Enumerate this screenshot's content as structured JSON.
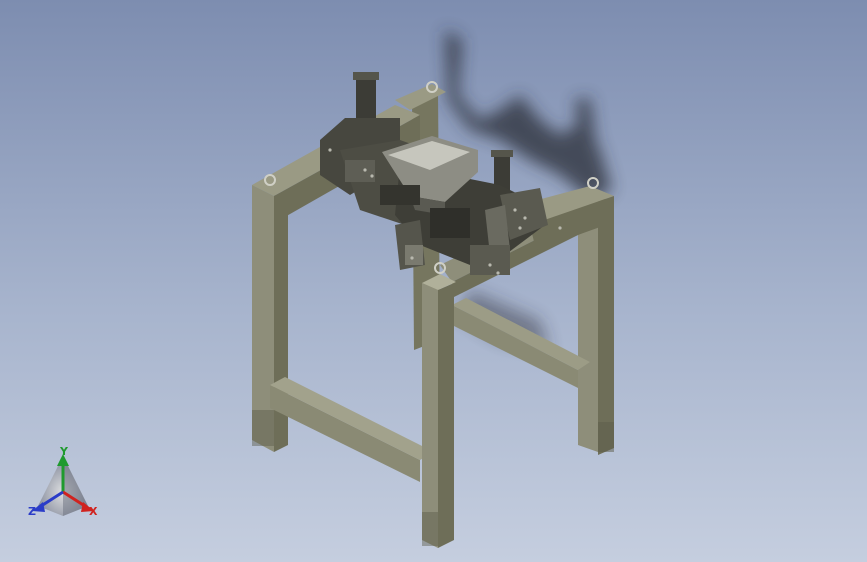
{
  "view_triad": {
    "y_label": "Y",
    "x_label": "X",
    "z_label": "Z",
    "colors": {
      "y": "#1f9a2e",
      "x": "#d0231f",
      "z": "#2a3cc8"
    }
  },
  "colors": {
    "background_top": "#7d8db0",
    "background_bottom": "#c5cedf",
    "frame_light": "#8e8e7a",
    "frame_mid": "#76765f",
    "frame_dark": "#5c5c4a",
    "mechanism": "#3c3c36",
    "shadow": "#2c2f38"
  },
  "model": {
    "icon": "machine-frame-assembly-icon"
  }
}
